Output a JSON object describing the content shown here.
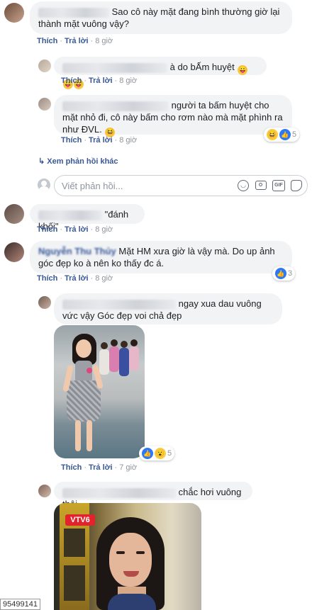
{
  "comments": [
    {
      "text": "Sao cô này mặt đang bình thường giờ lại thành mặt vuông vậy?",
      "actions": {
        "like": "Thích",
        "reply": "Trả lời",
        "time": "8 giờ"
      }
    },
    {
      "text": "à do bẤm huyệt",
      "actions": {
        "like": "Thích",
        "reply": "Trả lời",
        "time": "8 giờ"
      }
    },
    {
      "text": "người ta bấm huyệt cho mặt nhỏ đi, cô này bấm cho rơm nào mà mặt phình ra như ĐVL.",
      "actions": {
        "like": "Thích",
        "reply": "Trả lời",
        "time": "8 giờ"
      },
      "reaction_count": "5"
    }
  ],
  "more_replies": "Xem phản hồi khác",
  "reply_input": {
    "placeholder": "Viết phản hồi...",
    "icons": [
      "smile-icon",
      "camera-icon",
      "gif-icon",
      "sticker-icon"
    ],
    "gif_label": "GIF"
  },
  "comment4": {
    "text": "\"đánh khối\"",
    "actions": {
      "like": "Thích",
      "reply": "Trả lời",
      "time": "8 giờ"
    }
  },
  "comment5": {
    "author": "Nguyễn Thu Thủy",
    "text": "Mặt HM xưa giờ là vậy mà. Do up ảnh góc đẹp ko à nên ko thấy đc á.",
    "actions": {
      "like": "Thích",
      "reply": "Trả lời",
      "time": "8 giờ"
    },
    "reaction_count": "3"
  },
  "comment6": {
    "text": "ngay xua dau vuông vức vậy Góc đẹp voi chả đẹp",
    "actions": {
      "like": "Thích",
      "reply": "Trả lời",
      "time": "7 giờ"
    },
    "reaction_count": "5"
  },
  "comment7": {
    "text": "chắc hơi vuông thôi"
  },
  "watermark": "95499141",
  "logo_text": "VTV6",
  "colors": {
    "link": "#385898",
    "bubble": "#f2f3f5",
    "like_blue": "#2f78f5",
    "time": "#90949c"
  }
}
